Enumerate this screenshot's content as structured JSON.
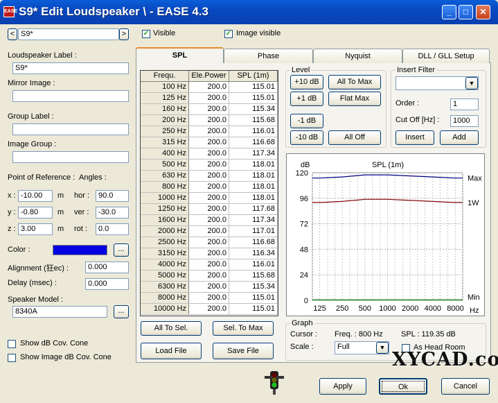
{
  "window": {
    "title": "S9* Edit Loudspeaker \\ - EASE 4.3",
    "icon_text": "EASE",
    "min": "_",
    "max": "□",
    "close": "✕"
  },
  "nav": {
    "prev": "<",
    "next": ">",
    "value": "S9*",
    "visible_label": "Visible",
    "image_visible_label": "Image visible"
  },
  "left": {
    "speaker_label": "Loudspeaker Label :",
    "speaker_value": "S9*",
    "mirror_label": "Mirror Image :",
    "mirror_value": "",
    "group_label": "Group Label :",
    "group_value": "",
    "image_group_label": "Image Group :",
    "image_group_value": "",
    "por_label": "Point of Reference :",
    "angles_label": "Angles :",
    "x_label": "x :",
    "x_value": "-10.00",
    "y_label": "y :",
    "y_value": "-0.80",
    "z_label": "z :",
    "z_value": "3.00",
    "m": "m",
    "hor_label": "hor :",
    "hor_value": "90.0",
    "ver_label": "ver :",
    "ver_value": "-30.0",
    "rot_label": "rot :",
    "rot_value": "0.0",
    "color_label": "Color :",
    "color_hex": "#0000e0",
    "ellipsis": "...",
    "alignment_label": "Alignment (狂ec) :",
    "alignment_value": "0.000",
    "delay_label": "Delay (msec) :",
    "delay_value": "0.000",
    "model_label": "Speaker Model :",
    "model_value": "8340A",
    "cov_cone": "Show dB Cov. Cone",
    "image_cov_cone": "Show Image dB Cov. Cone"
  },
  "tabs": [
    "SPL",
    "Phase",
    "Nyquist",
    "DLL / GLL Setup"
  ],
  "table": {
    "headers": [
      "Frequ.",
      "Ele.Power",
      "SPL (1m)"
    ],
    "rows": [
      [
        "100 Hz",
        "200.0",
        "115.01"
      ],
      [
        "125 Hz",
        "200.0",
        "115.01"
      ],
      [
        "160 Hz",
        "200.0",
        "115.34"
      ],
      [
        "200 Hz",
        "200.0",
        "115.68"
      ],
      [
        "250 Hz",
        "200.0",
        "116.01"
      ],
      [
        "315 Hz",
        "200.0",
        "116.68"
      ],
      [
        "400 Hz",
        "200.0",
        "117.34"
      ],
      [
        "500 Hz",
        "200.0",
        "118.01"
      ],
      [
        "630 Hz",
        "200.0",
        "118.01"
      ],
      [
        "800 Hz",
        "200.0",
        "118.01"
      ],
      [
        "1000 Hz",
        "200.0",
        "118.01"
      ],
      [
        "1250 Hz",
        "200.0",
        "117.68"
      ],
      [
        "1600 Hz",
        "200.0",
        "117.34"
      ],
      [
        "2000 Hz",
        "200.0",
        "117.01"
      ],
      [
        "2500 Hz",
        "200.0",
        "116.68"
      ],
      [
        "3150 Hz",
        "200.0",
        "116.34"
      ],
      [
        "4000 Hz",
        "200.0",
        "116.01"
      ],
      [
        "5000 Hz",
        "200.0",
        "115.68"
      ],
      [
        "6300 Hz",
        "200.0",
        "115.34"
      ],
      [
        "8000 Hz",
        "200.0",
        "115.01"
      ],
      [
        "10000 Hz",
        "200.0",
        "115.01"
      ]
    ]
  },
  "table_buttons": {
    "all_to_sel": "All To Sel.",
    "sel_to_max": "Sel. To Max",
    "load_file": "Load File",
    "save_file": "Save File"
  },
  "level": {
    "title": "Level",
    "p10": "+10 dB",
    "all_to_max": "All To Max",
    "p1": "+1 dB",
    "flat_max": "Flat Max",
    "m1": "-1 dB",
    "m10": "-10 dB",
    "all_off": "All Off"
  },
  "insert_filter": {
    "title": "Insert Filter",
    "order_label": "Order :",
    "order_value": "1",
    "cutoff_label": "Cut Off [Hz] :",
    "cutoff_value": "1000",
    "insert": "Insert",
    "add": "Add"
  },
  "chart_data": {
    "type": "line",
    "title": "SPL (1m)",
    "ylabel": "dB",
    "xlabel": "Hz",
    "ylim": [
      0,
      120
    ],
    "yticks": [
      120,
      96,
      72,
      48,
      24,
      0
    ],
    "xticks": [
      "125",
      "250",
      "500",
      "1000",
      "2000",
      "4000",
      "8000"
    ],
    "x": [
      100,
      125,
      160,
      200,
      250,
      315,
      400,
      500,
      630,
      800,
      1000,
      1250,
      1600,
      2000,
      2500,
      3150,
      4000,
      5000,
      6300,
      8000,
      10000
    ],
    "series": [
      {
        "name": "Max",
        "color": "#000080",
        "values": [
          115.01,
          115.01,
          115.34,
          115.68,
          116.01,
          116.68,
          117.34,
          118.01,
          118.01,
          118.01,
          118.01,
          117.68,
          117.34,
          117.01,
          116.68,
          116.34,
          116.01,
          115.68,
          115.34,
          115.01,
          115.01
        ]
      },
      {
        "name": "1W",
        "color": "#800000",
        "values": [
          92,
          92,
          92.3,
          92.7,
          93,
          93.7,
          94.3,
          95,
          95,
          95,
          95,
          94.7,
          94.3,
          94,
          93.7,
          93.3,
          93,
          92.7,
          92.3,
          92,
          92
        ]
      },
      {
        "name": "Min",
        "color": "#008000",
        "values": [
          0.5,
          0.5,
          0.5,
          0.5,
          0.5,
          0.5,
          0.5,
          0.5,
          0.5,
          0.5,
          0.5,
          0.5,
          0.5,
          0.5,
          0.5,
          0.5,
          0.5,
          0.5,
          0.5,
          0.5,
          0.5
        ]
      }
    ],
    "grid": true
  },
  "graph": {
    "title": "Graph",
    "cursor_label": "Cursor :",
    "freq": "Freq. : 800 Hz",
    "spl": "SPL : 119.35 dB",
    "scale_label": "Scale :",
    "scale_value": "Full",
    "headroom": "As Head Room"
  },
  "footer": {
    "apply": "Apply",
    "ok": "Ok",
    "cancel": "Cancel"
  },
  "watermark": "XYCAD.com"
}
